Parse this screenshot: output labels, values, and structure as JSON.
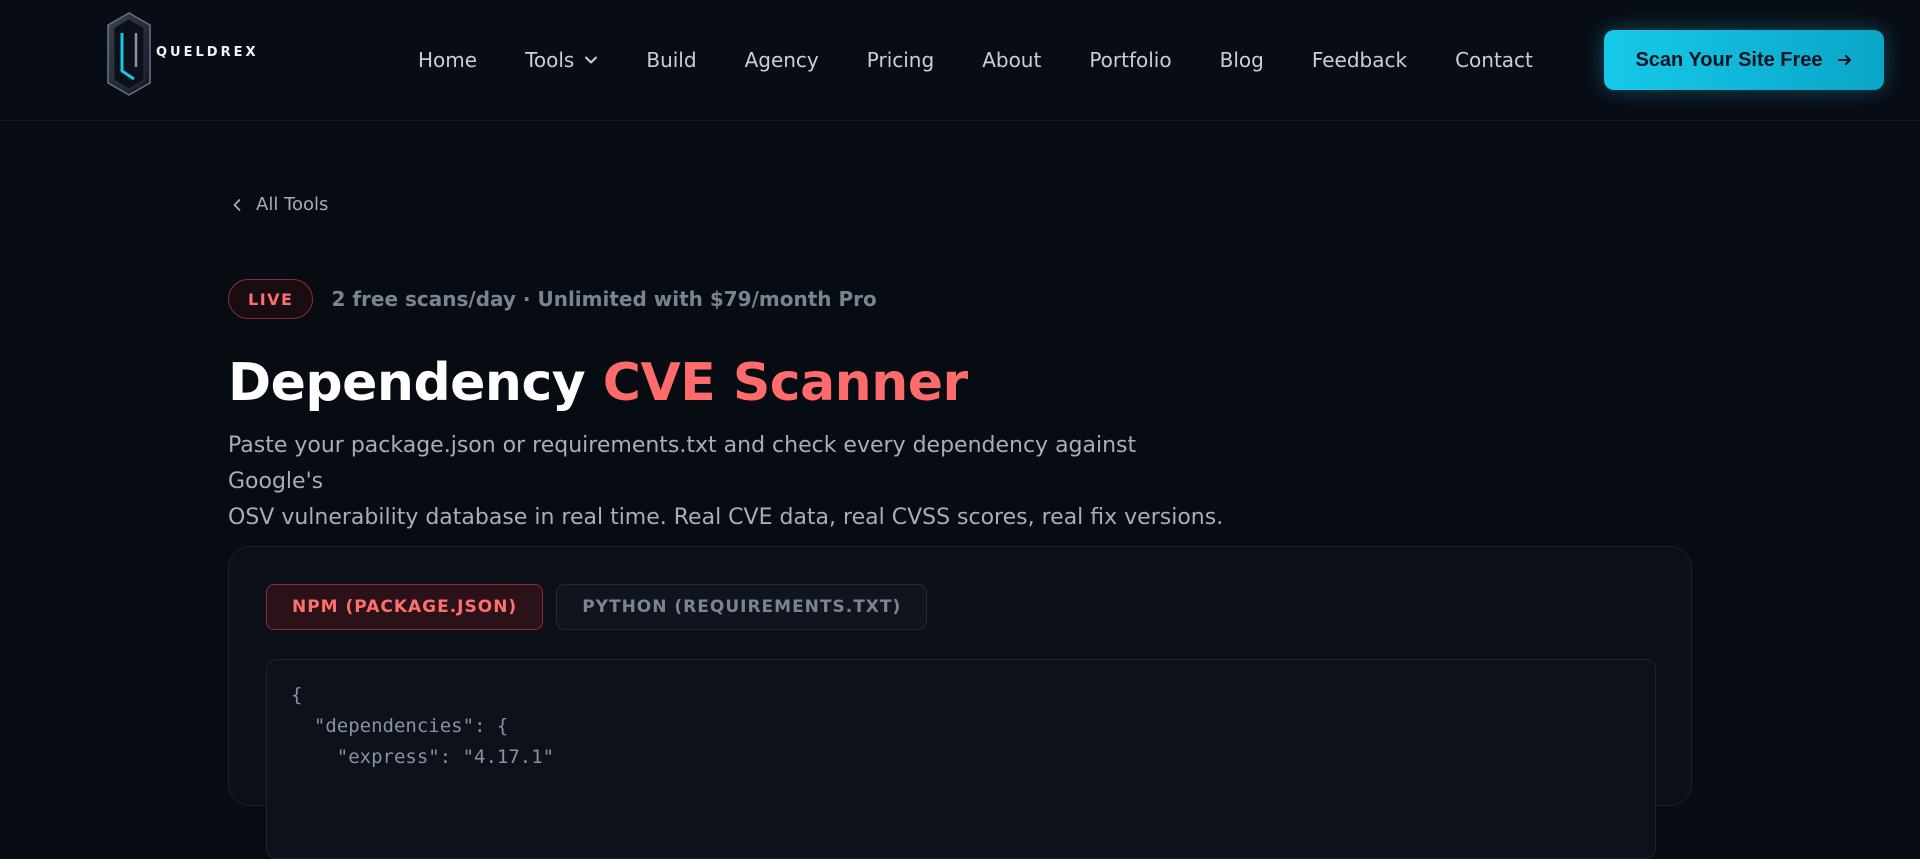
{
  "brand": {
    "name": "QUELDREX",
    "accent": "#17c9e9",
    "highlight": "#ff6b6b"
  },
  "nav": {
    "items": [
      {
        "label": "Home"
      },
      {
        "label": "Tools",
        "has_dropdown": true
      },
      {
        "label": "Build"
      },
      {
        "label": "Agency"
      },
      {
        "label": "Pricing"
      },
      {
        "label": "About"
      },
      {
        "label": "Portfolio"
      },
      {
        "label": "Blog"
      },
      {
        "label": "Feedback"
      },
      {
        "label": "Contact"
      }
    ],
    "cta_label": "Scan Your Site Free"
  },
  "breadcrumb": {
    "back_label": "All Tools"
  },
  "hero": {
    "badge": "LIVE",
    "plan_note": "2 free scans/day · Unlimited with $79/month Pro",
    "title_part1": "Dependency ",
    "title_part2": "CVE Scanner",
    "description_line1": "Paste your package.json or requirements.txt and check every dependency against Google's",
    "description_line2": "OSV vulnerability database in real time. Real CVE data, real CVSS scores, real fix versions."
  },
  "scanner": {
    "tabs": [
      {
        "label": "NPM (PACKAGE.JSON)",
        "active": true
      },
      {
        "label": "PYTHON (REQUIREMENTS.TXT)",
        "active": false
      }
    ],
    "editor_placeholder": "{\n  \"dependencies\": {\n    \"express\": \"4.17.1\""
  }
}
